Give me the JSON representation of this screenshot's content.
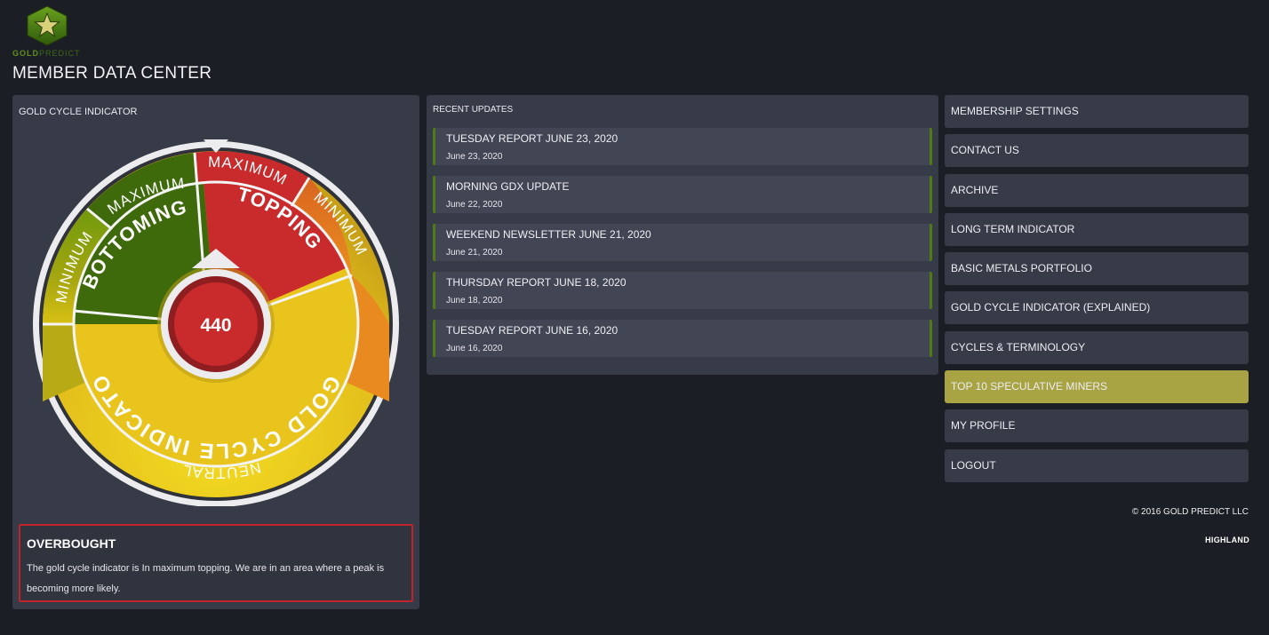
{
  "brand": {
    "logo_icon": "star-hexagon-icon",
    "name_part1": "GOLD",
    "name_part2": "PREDICT"
  },
  "page_title": "MEMBER DATA CENTER",
  "gauge_panel": {
    "title": "GOLD CYCLE INDICATOR",
    "value": "440",
    "segments": {
      "bottoming": "BOTTOMING",
      "topping": "TOPPING",
      "max_left": "MAXIMUM",
      "max_right": "MAXIMUM",
      "min_left": "MINIMUM",
      "min_right": "MINIMUM",
      "neutral": "NEUTRAL",
      "indicator": "GOLD CYCLE INDICATOR"
    },
    "colors": {
      "green": "#3e6a0c",
      "red": "#c92a2c",
      "yellow": "#e6c21c",
      "orange": "#e27a20"
    },
    "status": {
      "title": "OVERBOUGHT",
      "text": "The gold cycle indicator is In maximum topping. We are in an area where a peak is becoming more likely."
    }
  },
  "updates_panel": {
    "title": "RECENT UPDATES",
    "items": [
      {
        "title": "TUESDAY REPORT JUNE 23, 2020",
        "date": "June 23, 2020"
      },
      {
        "title": "MORNING GDX UPDATE",
        "date": "June 22, 2020"
      },
      {
        "title": "WEEKEND NEWSLETTER JUNE 21, 2020",
        "date": "June 21, 2020"
      },
      {
        "title": "THURSDAY REPORT JUNE 18, 2020",
        "date": "June 18, 2020"
      },
      {
        "title": "TUESDAY REPORT JUNE 16, 2020",
        "date": "June 16, 2020"
      }
    ]
  },
  "menu": [
    {
      "label": "MEMBERSHIP SETTINGS"
    },
    {
      "label": "CONTACT US"
    },
    {
      "label": "ARCHIVE"
    },
    {
      "label": "LONG TERM INDICATOR"
    },
    {
      "label": "BASIC METALS PORTFOLIO"
    },
    {
      "label": "GOLD CYCLE INDICATOR (EXPLAINED)"
    },
    {
      "label": "CYCLES & TERMINOLOGY"
    },
    {
      "label": "TOP 10 SPECULATIVE MINERS",
      "highlight": true
    },
    {
      "label": "MY PROFILE"
    },
    {
      "label": "LOGOUT"
    }
  ],
  "footer": {
    "copyright": "© 2016 GOLD PREDICT LLC",
    "credit": "HIGHLAND"
  }
}
